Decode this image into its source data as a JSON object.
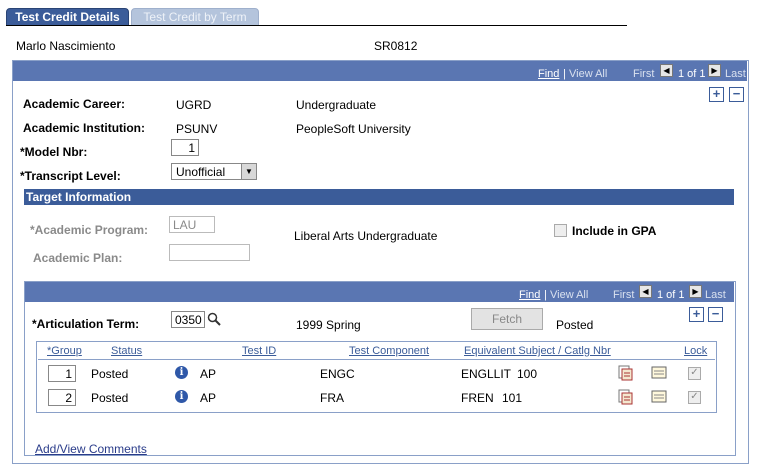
{
  "tabs": [
    {
      "label": "Test Credit Details"
    },
    {
      "label": "Test Credit by Term"
    }
  ],
  "header": {
    "name": "Marlo Nascimiento",
    "id": "SR0812"
  },
  "outer_nav": {
    "find": "Find",
    "view_all": "View All",
    "first": "First",
    "pager": "1 of 1",
    "last": "Last"
  },
  "form": {
    "career_label": "Academic Career:",
    "career_code": "UGRD",
    "career_desc": "Undergraduate",
    "institution_label": "Academic Institution:",
    "institution_code": "PSUNV",
    "institution_desc": "PeopleSoft University",
    "model_label": "*Model Nbr:",
    "model_value": "1",
    "transcript_label": "*Transcript Level:",
    "transcript_value": "Unofficial"
  },
  "target": {
    "header": "Target Information",
    "program_label": "*Academic Program:",
    "program_value": "LAU",
    "program_desc": "Liberal Arts Undergraduate",
    "plan_label": "Academic Plan:",
    "plan_value": "",
    "gpa_label": "Include in GPA"
  },
  "inner_nav": {
    "find": "Find",
    "view_all": "View All",
    "first": "First",
    "pager": "1 of 1",
    "last": "Last"
  },
  "articulation": {
    "label": "*Articulation Term:",
    "term": "0350",
    "term_desc": "1999 Spring",
    "fetch_label": "Fetch",
    "status": "Posted"
  },
  "grid": {
    "headers": [
      "*Group",
      "Status",
      "Test ID",
      "Test Component",
      "Equivalent Subject / Catlg Nbr",
      "Lock"
    ],
    "rows": [
      {
        "group": "1",
        "status": "Posted",
        "test_id": "AP",
        "component": "ENGC",
        "subject": "ENGLLIT",
        "catalog": "100"
      },
      {
        "group": "2",
        "status": "Posted",
        "test_id": "AP",
        "component": "FRA",
        "subject": "FREN",
        "catalog": "101"
      }
    ]
  },
  "footer": {
    "comments_link": "Add/View Comments"
  },
  "colors": {
    "accent": "#3b5c99",
    "navbar": "#5a76b2"
  }
}
